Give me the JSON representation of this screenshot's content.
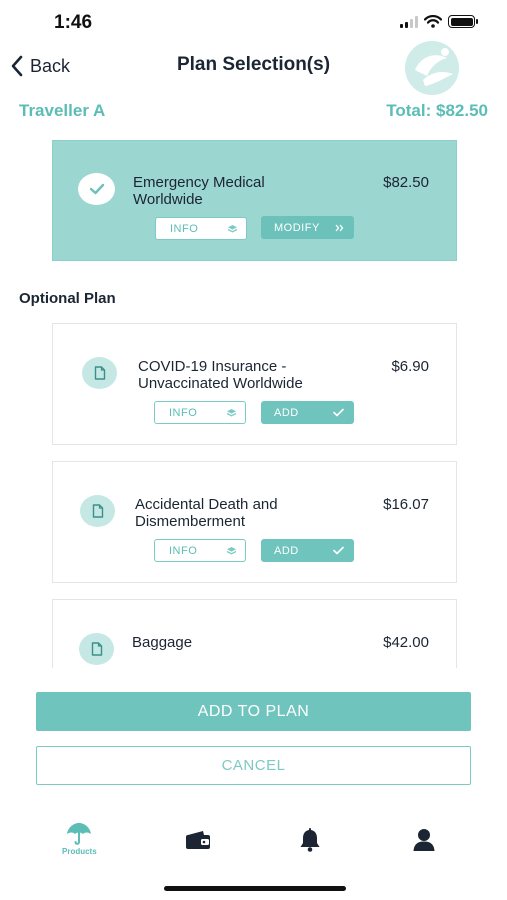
{
  "status_bar": {
    "time": "1:46"
  },
  "header": {
    "back_label": "Back",
    "title": "Plan Selection(s)"
  },
  "summary": {
    "traveller": "Traveller A",
    "total": "Total: $82.50"
  },
  "selected_plan": {
    "name": "Emergency Medical Worldwide",
    "price": "$82.50",
    "info_label": "INFO",
    "modify_label": "MODIFY",
    "checked": true
  },
  "optional_section_label": "Optional Plan",
  "optional_plans": [
    {
      "name": "COVID-19 Insurance - Unvaccinated Worldwide",
      "price": "$6.90",
      "info_label": "INFO",
      "add_label": "ADD"
    },
    {
      "name": "Accidental Death and Dismemberment",
      "price": "$16.07",
      "info_label": "INFO",
      "add_label": "ADD"
    },
    {
      "name": "Baggage",
      "price": "$42.00"
    }
  ],
  "actions": {
    "add_to_plan": "ADD TO PLAN",
    "cancel": "CANCEL"
  },
  "tab_bar": [
    {
      "label": "Products",
      "icon": "umbrella-icon",
      "active": true
    },
    {
      "icon": "wallet-icon"
    },
    {
      "icon": "bell-icon"
    },
    {
      "icon": "user-icon"
    }
  ],
  "colors": {
    "accent": "#6fc4bd",
    "accent_text": "#5bbdb6",
    "selected_card": "#9bd6d1",
    "text": "#1c2533"
  }
}
